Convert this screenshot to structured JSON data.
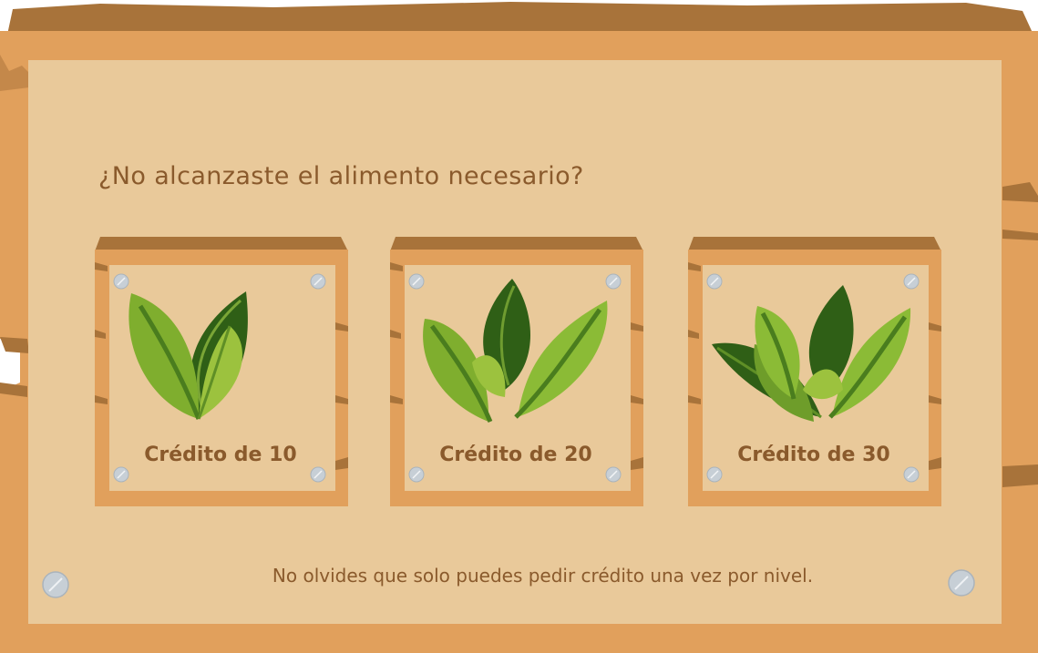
{
  "dialog": {
    "question": "¿No alcanzaste el alimento necesario?",
    "footer_note": "No olvides que solo puedes pedir crédito una vez por nivel."
  },
  "credit_options": [
    {
      "label": "Crédito de 10",
      "icon": "leaves-icon-two"
    },
    {
      "label": "Crédito de 20",
      "icon": "leaves-icon-three"
    },
    {
      "label": "Crédito de 30",
      "icon": "leaves-icon-four"
    }
  ],
  "colors": {
    "frame_outer": "#a8733a",
    "frame_mid": "#e1a05c",
    "panel": "#e9c99a",
    "text": "#8a5a2c",
    "leaf_light": "#9cc23e",
    "leaf_mid": "#6e9d2a",
    "leaf_dark": "#2f5f16",
    "screw": "#c7cfd6"
  }
}
